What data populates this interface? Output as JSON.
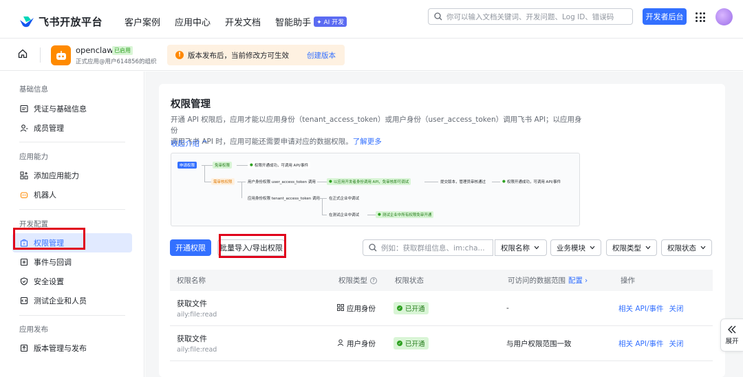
{
  "header": {
    "brand": "飞书开放平台",
    "nav": [
      "客户案例",
      "应用中心",
      "开发文档",
      "智能助手"
    ],
    "ai_badge": "✦ AI 开发",
    "search_placeholder": "你可以输入文档关键词、开发问题、Log ID、错误码",
    "dev_console": "开发者后台"
  },
  "app": {
    "name": "openclaw",
    "status": "已启用",
    "subtitle": "正式应用@用户614856的组织",
    "notice": "版本发布后，当前修改方可生效",
    "notice_link": "创建版本"
  },
  "sidebar": {
    "groups": [
      "基础信息",
      "应用能力",
      "开发配置",
      "应用发布"
    ],
    "items": [
      {
        "label": "凭证与基础信息",
        "icon": "credential-icon"
      },
      {
        "label": "成员管理",
        "icon": "member-icon"
      },
      {
        "label": "添加应用能力",
        "icon": "add-capability-icon"
      },
      {
        "label": "机器人",
        "icon": "robot-icon"
      },
      {
        "label": "权限管理",
        "icon": "permission-icon"
      },
      {
        "label": "事件与回调",
        "icon": "event-icon"
      },
      {
        "label": "安全设置",
        "icon": "shield-icon"
      },
      {
        "label": "测试企业和人员",
        "icon": "test-icon"
      },
      {
        "label": "版本管理与发布",
        "icon": "publish-icon"
      }
    ]
  },
  "page": {
    "title": "权限管理",
    "desc1": "开通 API 权限后，应用才能以应用身份（tenant_access_token）或用户身份（user_access_token）调用飞书 API；以应用身份",
    "desc2": "调用飞书 API 时，应用可能还需要申请对应的数据权限。",
    "desc_link": "了解更多",
    "collapse": "收起介绍 ^"
  },
  "flow": {
    "apply": "申请权限",
    "free": "免审权限",
    "free_result": "权限开通成功，可调用 API/事件",
    "review": "需审核权限",
    "user_identity": "用户身份权限 user_access_token 调用",
    "user_result": "以应用开发者身份调用 API，免审核即可调试",
    "submit": "提交版本，管理员审核通过",
    "final_result": "权限开通成功，可调用 API/事件",
    "app_identity": "应用身份权限 tenant_access_token 调用",
    "formal": "在正式企业中调试",
    "test": "在测试企业中调试",
    "test_result": "测试企业中所有权限免审开通"
  },
  "toolbar": {
    "open_btn": "开通权限",
    "batch_btn": "批量导入/导出权限",
    "search_placeholder": "例如：获取群组信息、im:cha...",
    "filters": [
      "权限名称",
      "业务模块",
      "权限类型",
      "权限状态"
    ]
  },
  "table": {
    "headers": [
      "权限名称",
      "权限类型",
      "权限状态",
      "可访问的数据范围",
      "配置",
      "操作"
    ],
    "rows": [
      {
        "name": "获取文件",
        "scope": "aily:file:read",
        "type": "应用身份",
        "type_icon": "app-identity-icon",
        "status": "已开通",
        "range": "-",
        "action1": "相关 API/事件",
        "action2": "关闭"
      },
      {
        "name": "获取文件",
        "scope": "aily:file:read",
        "type": "用户身份",
        "type_icon": "user-identity-icon",
        "status": "已开通",
        "range": "与用户权限范围一致",
        "action1": "相关 API/事件",
        "action2": "关闭"
      }
    ]
  },
  "float": {
    "label": "展开"
  }
}
